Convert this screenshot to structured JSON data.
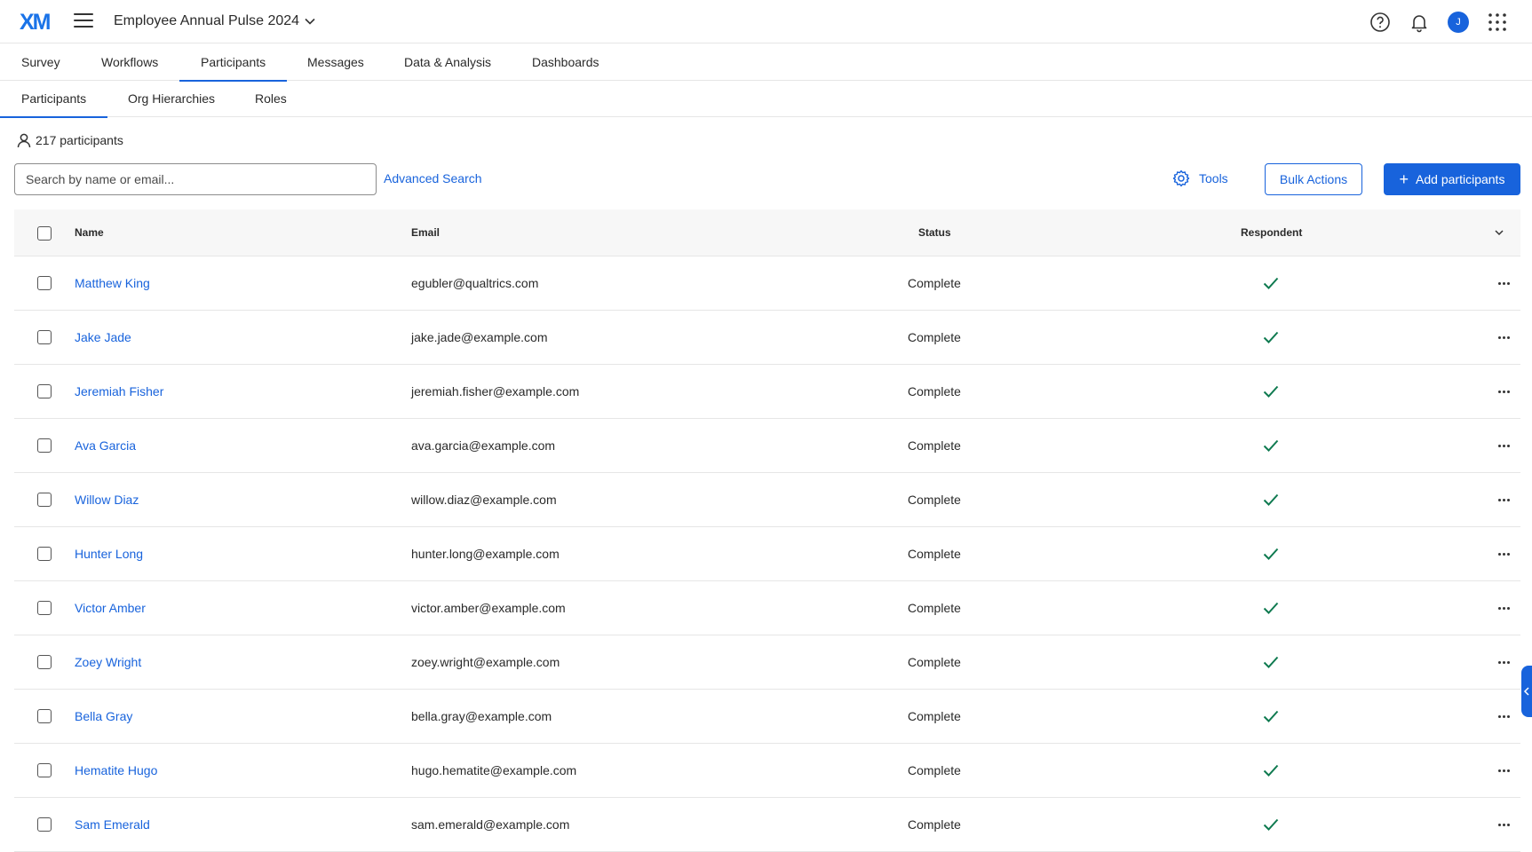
{
  "header": {
    "logo": "XM",
    "project_title": "Employee Annual Pulse 2024",
    "avatar_initial": "J",
    "icons": [
      "menu-icon",
      "chevron-down-icon",
      "help-icon",
      "bell-icon",
      "avatar",
      "app-grid-icon"
    ]
  },
  "main_tabs": [
    {
      "label": "Survey"
    },
    {
      "label": "Workflows"
    },
    {
      "label": "Participants",
      "active": true
    },
    {
      "label": "Messages"
    },
    {
      "label": "Data & Analysis"
    },
    {
      "label": "Dashboards"
    }
  ],
  "sub_tabs": [
    {
      "label": "Participants",
      "active": true
    },
    {
      "label": "Org Hierarchies"
    },
    {
      "label": "Roles"
    }
  ],
  "toolbar": {
    "participant_count": "217 participants",
    "search_placeholder": "Search by name or email...",
    "search_value": "",
    "advanced_search": "Advanced Search",
    "tools": "Tools",
    "bulk_actions": "Bulk Actions",
    "add_participants": "Add participants"
  },
  "table": {
    "columns": [
      "Name",
      "Email",
      "Status",
      "Respondent"
    ],
    "rows": [
      {
        "name": "Matthew King",
        "email": "egubler@qualtrics.com",
        "status": "Complete",
        "respondent": true
      },
      {
        "name": "Jake Jade",
        "email": "jake.jade@example.com",
        "status": "Complete",
        "respondent": true
      },
      {
        "name": "Jeremiah Fisher",
        "email": "jeremiah.fisher@example.com",
        "status": "Complete",
        "respondent": true
      },
      {
        "name": "Ava Garcia",
        "email": "ava.garcia@example.com",
        "status": "Complete",
        "respondent": true
      },
      {
        "name": "Willow Diaz",
        "email": "willow.diaz@example.com",
        "status": "Complete",
        "respondent": true
      },
      {
        "name": "Hunter Long",
        "email": "hunter.long@example.com",
        "status": "Complete",
        "respondent": true
      },
      {
        "name": "Victor Amber",
        "email": "victor.amber@example.com",
        "status": "Complete",
        "respondent": true
      },
      {
        "name": "Zoey Wright",
        "email": "zoey.wright@example.com",
        "status": "Complete",
        "respondent": true
      },
      {
        "name": "Bella Gray",
        "email": "bella.gray@example.com",
        "status": "Complete",
        "respondent": true
      },
      {
        "name": "Hematite Hugo",
        "email": "hugo.hematite@example.com",
        "status": "Complete",
        "respondent": true
      },
      {
        "name": "Sam Emerald",
        "email": "sam.emerald@example.com",
        "status": "Complete",
        "respondent": true
      }
    ]
  },
  "colors": {
    "accent": "#1863dc",
    "check": "#0f7a50",
    "header_bg": "#f7f7f7",
    "border": "#e6e6e6"
  }
}
